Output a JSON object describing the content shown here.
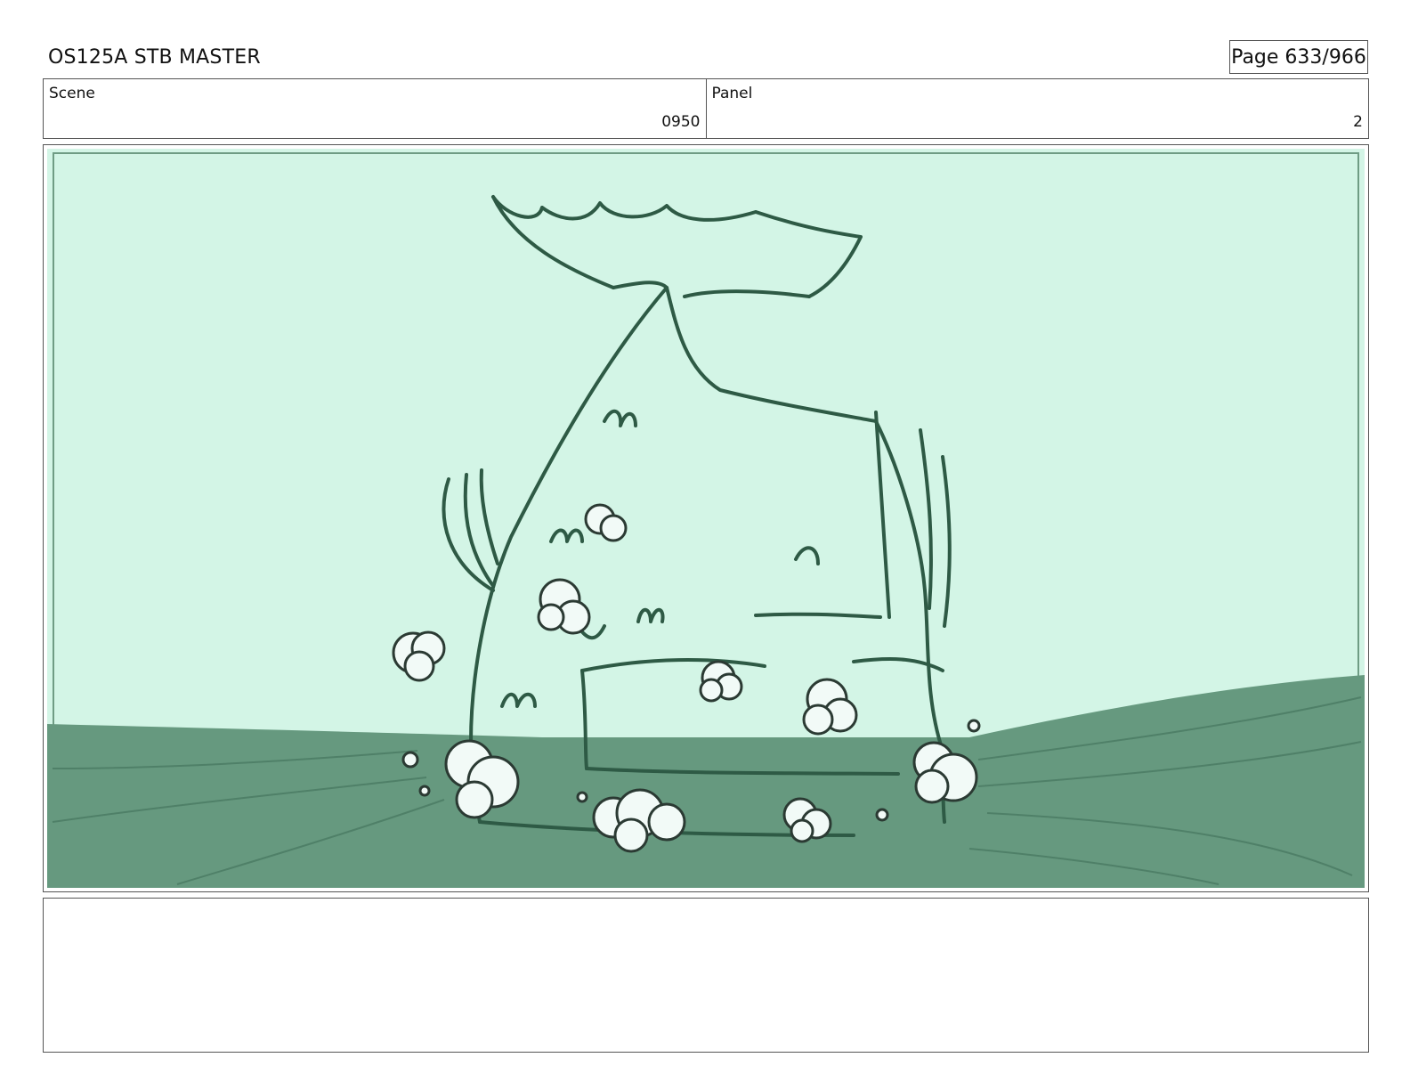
{
  "header": {
    "title": "OS125A STB MASTER",
    "page": "Page 633/966"
  },
  "scene": {
    "label": "Scene",
    "value": "0950"
  },
  "panel": {
    "label": "Panel",
    "value": "2"
  },
  "artwork": {
    "subject": "fish-sketch",
    "colors": {
      "sky": "#d3f5e6",
      "water": "#66997f",
      "line": "#2e5a45",
      "foam": "#f2faf7"
    }
  },
  "notes": {
    "text": ""
  }
}
